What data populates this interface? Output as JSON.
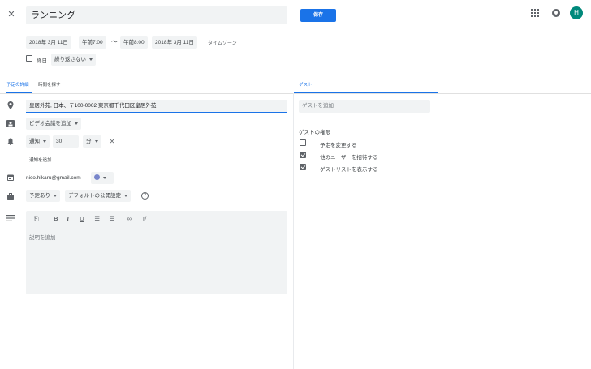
{
  "header": {
    "title": "ランニング",
    "save_label": "保存",
    "avatar_initial": "H"
  },
  "datetime": {
    "start_date": "2018年 3月 11日",
    "start_time": "午前7:00",
    "separator": "～",
    "end_time": "午前8:00",
    "end_date": "2018年 3月 11日",
    "timezone_label": "タイムゾーン",
    "all_day_label": "終日",
    "repeat_label": "繰り返さない"
  },
  "tabs": {
    "details": "予定の詳細",
    "find_time": "時間を探す",
    "guests": "ゲスト"
  },
  "details": {
    "location_value": "皇居外苑, 日本、〒100-0002 東京都千代田区皇居外苑",
    "conference_label": "ビデオ会議を追加",
    "notification_type": "通知",
    "notification_amount": "30",
    "notification_unit": "分",
    "add_notification": "通知を追加",
    "calendar_owner": "nico.hikaru@gmail.com",
    "busy_status": "予定あり",
    "visibility": "デフォルトの公開設定",
    "description_placeholder": "説明を追加"
  },
  "guests": {
    "add_placeholder": "ゲストを追加",
    "permissions_title": "ゲストの権限",
    "permissions": [
      {
        "label": "予定を変更する",
        "checked": false
      },
      {
        "label": "他のユーザーを招待する",
        "checked": true
      },
      {
        "label": "ゲストリストを表示する",
        "checked": true
      }
    ]
  },
  "colors": {
    "accent": "#1a73e8",
    "calendar_color": "#7986cb",
    "avatar": "#00897b"
  }
}
